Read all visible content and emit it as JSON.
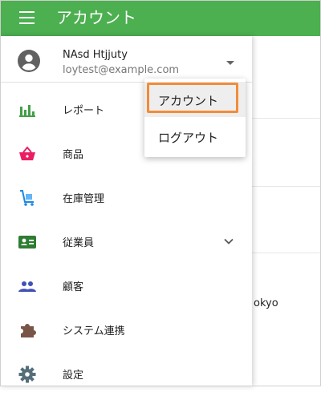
{
  "app_bar": {
    "title": "アカウント"
  },
  "account": {
    "name": "NAsd Htjjuty",
    "email": "loytest@example.com"
  },
  "nav": {
    "reports": "レポート",
    "products": "商品",
    "inventory": "在庫管理",
    "staff": "従業員",
    "customers": "顧客",
    "integrations": "システム連携",
    "settings": "設定"
  },
  "account_menu": {
    "account": "アカウント",
    "logout": "ログアウト"
  },
  "background": {
    "fragment": "okyo"
  },
  "colors": {
    "app_bar": "#4caf50",
    "focus": "#f28c38",
    "reports_icon": "#43a047",
    "products_icon": "#e91e63",
    "inventory_icon": "#1e88e5",
    "staff_icon": "#2e7d32",
    "customers_icon": "#3f51b5",
    "integrations_icon": "#795548",
    "settings_icon": "#546e7a"
  },
  "icons": {
    "menu": "hamburger-menu-icon",
    "avatar": "account-circle-icon",
    "reports": "bar-chart-icon",
    "products": "shopping-basket-icon",
    "inventory": "cart-inventory-icon",
    "staff": "id-card-icon",
    "customers": "people-icon",
    "integrations": "puzzle-icon",
    "settings": "gear-icon"
  }
}
